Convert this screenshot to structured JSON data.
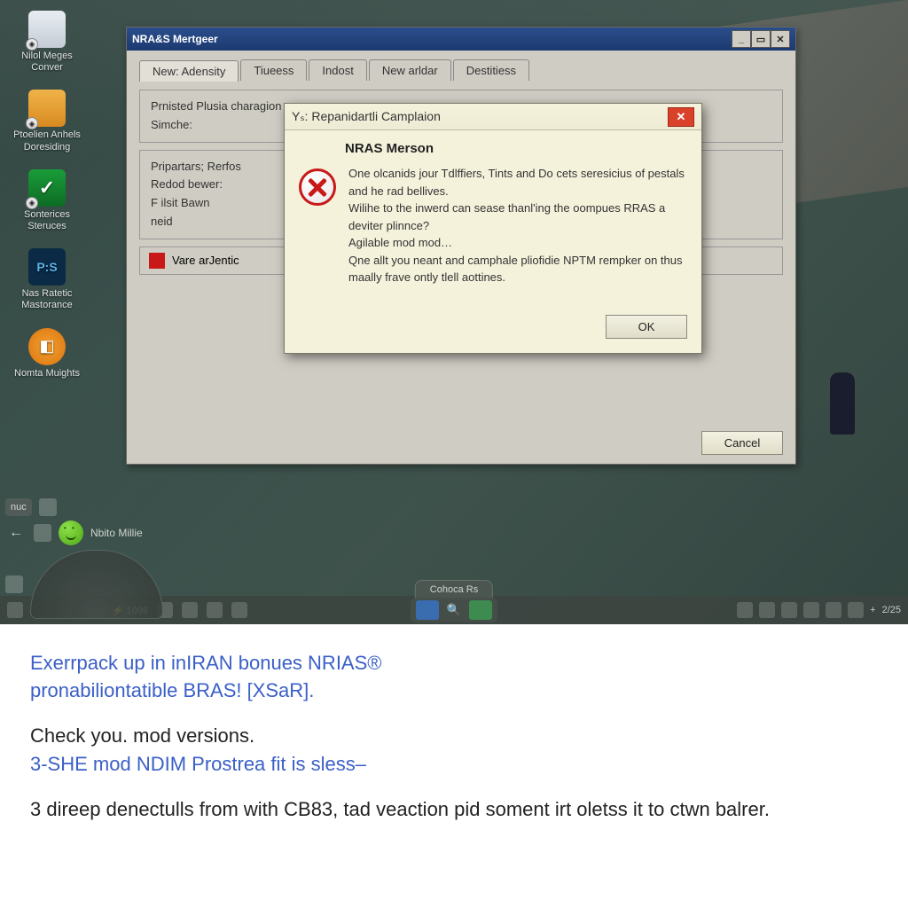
{
  "desktop": {
    "icons": [
      {
        "label": "Nilol Meges Conver"
      },
      {
        "label": "Ptoelien Anhels Doresiding"
      },
      {
        "label": "Sonterices Steruces"
      },
      {
        "label": "P:S",
        "sub": "Nas Ratetic Mastorance"
      },
      {
        "label": "Nomta Muights"
      }
    ]
  },
  "main_window": {
    "title": "NRA&S Mertgeer",
    "tabs": [
      "New: Adensity",
      "Tiueess",
      "Indost",
      "New arldar",
      "Destitiess"
    ],
    "group1": {
      "line1": "Prnisted Plusia charagion",
      "line2": "Simche:"
    },
    "group2": {
      "line1": "Pripartars; Rerfos",
      "line2": "Redod bewer:",
      "line3": "F ilsit Bawn",
      "line4": "neid"
    },
    "box_label": "Vare arJentic",
    "cancel": "Cancel"
  },
  "modal": {
    "title": "Yₛ: Repanidartli Camplaion",
    "heading": "NRAS Merson",
    "body": "One olcanids jour Tdlffiers, Tints and Do cets seresicius of pestals and he rad bellives.\nWilihe to the inwerd can sease thanl'ing the oompues RRAS a deviter plinnce?\nAgilable mod mod…\nQne allt you neant and camphale pliofidie NPTM rempker on thus maally frave ontly tlell aottines.",
    "ok": "OK"
  },
  "hud": {
    "name": "Nbito Millie",
    "count": "1096",
    "center_tab": "Cohoca Rs",
    "right_label": "2/25"
  },
  "article": {
    "p1a": "Exerrpack up in inIRAN bonues NRIAS®",
    "p1b": "pronabiliontatible BRAS! [XSaR].",
    "p2a": "Check you. mod versions.",
    "p2b": "3-SHE mod NDIM Prostrea fit is sless–",
    "p3": "3 direep denectulls from with CB83, tad veaction pid soment irt oletss it to ctwn balrer."
  }
}
